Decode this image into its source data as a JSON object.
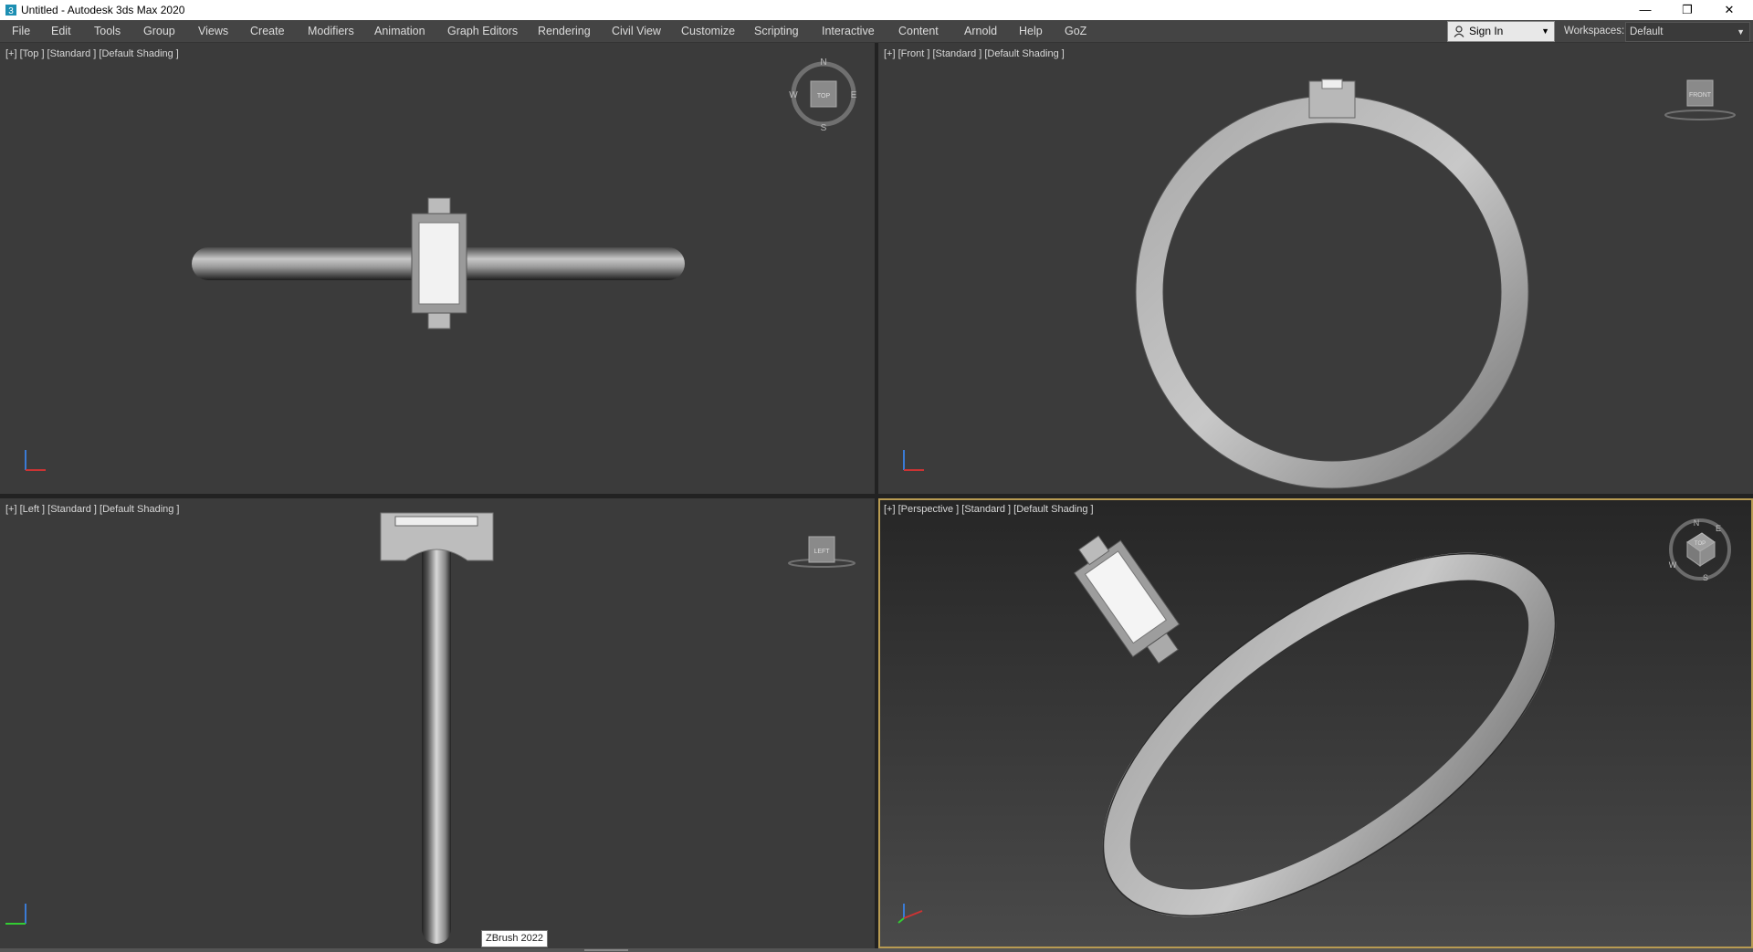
{
  "window": {
    "title": "Untitled - Autodesk 3ds Max 2020",
    "controls": [
      "—",
      "❐",
      "✕"
    ]
  },
  "menu": [
    "File",
    "Edit",
    "Tools",
    "Group",
    "Views",
    "Create",
    "Modifiers",
    "Animation",
    "Graph Editors",
    "Rendering",
    "Civil View",
    "Customize",
    "Scripting",
    "Interactive",
    "Content",
    "Arnold",
    "Help",
    "GoZ"
  ],
  "account": {
    "sign_in": "Sign In"
  },
  "workspaces": {
    "label": "Workspaces:",
    "value": "Default"
  },
  "viewports": {
    "top": {
      "label": "[+] [Top ] [Standard ] [Default Shading ]",
      "cube": "TOP",
      "compass": [
        "N",
        "E",
        "S",
        "W"
      ]
    },
    "front": {
      "label": "[+] [Front ] [Standard ] [Default Shading ]",
      "cube": "FRONT"
    },
    "left": {
      "label": "[+] [Left ] [Standard ] [Default Shading ]",
      "cube": "LEFT"
    },
    "persp": {
      "label": "[+] [Perspective ] [Standard ] [Default Shading ]",
      "cube": "TOP",
      "compass": [
        "N",
        "E",
        "S",
        "W"
      ]
    }
  },
  "tooltip": "ZBrush 2022",
  "colors": {
    "active_viewport_border": "#b89b52",
    "viewport_bg": "#3b3b3b",
    "menubar_bg": "#444444"
  }
}
